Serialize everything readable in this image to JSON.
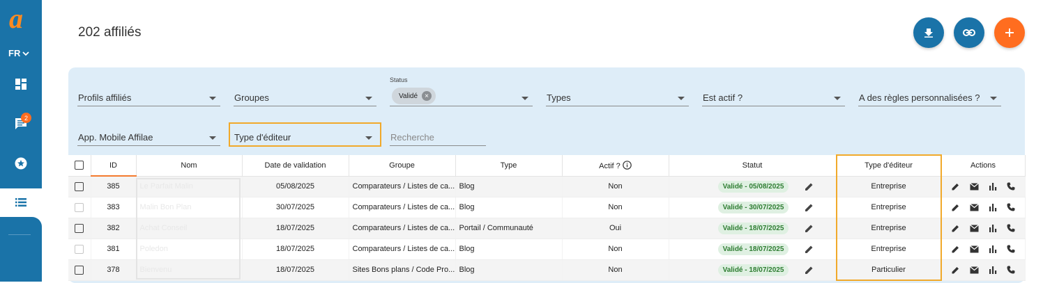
{
  "sidebar": {
    "language": "FR",
    "badge_count": "2",
    "brand_colors": {
      "primary": "#1a73a8",
      "accent": "#ff6d1f"
    }
  },
  "header": {
    "title": "202 affiliés",
    "actions": [
      {
        "icon": "download-icon",
        "color": "#1a73a8"
      },
      {
        "icon": "link-icon",
        "color": "#1a73a8"
      },
      {
        "icon": "plus-icon",
        "color": "#ff6d1f"
      }
    ]
  },
  "filters": {
    "profils": "Profils affiliés",
    "groupes": "Groupes",
    "status_label": "Status",
    "status_chip": "Validé",
    "types": "Types",
    "est_actif": "Est actif ?",
    "regles": "A des règles personnalisées ?",
    "app_mobile": "App. Mobile Affilae",
    "type_editeur": "Type d'éditeur",
    "search_placeholder": "Recherche"
  },
  "table": {
    "headers": {
      "id": "ID",
      "nom": "Nom",
      "date": "Date de validation",
      "groupe": "Groupe",
      "type": "Type",
      "actif": "Actif ?",
      "statut": "Statut",
      "type_editeur": "Type d'éditeur",
      "actions": "Actions"
    },
    "rows": [
      {
        "id": "385",
        "nom": "Le Parfait Malin",
        "date": "05/08/2025",
        "groupe": "Comparateurs / Listes de ca...",
        "type": "Blog",
        "actif": "Non",
        "statut": "Validé - 05/08/2025",
        "type_editeur": "Entreprise"
      },
      {
        "id": "383",
        "nom": "Malin Bon Plan",
        "date": "30/07/2025",
        "groupe": "Comparateurs / Listes de ca...",
        "type": "Blog",
        "actif": "Non",
        "statut": "Validé - 30/07/2025",
        "type_editeur": "Entreprise"
      },
      {
        "id": "382",
        "nom": "Achat Conseil",
        "date": "18/07/2025",
        "groupe": "Comparateurs / Listes de ca...",
        "type": "Portail / Communauté",
        "actif": "Oui",
        "statut": "Validé - 18/07/2025",
        "type_editeur": "Entreprise"
      },
      {
        "id": "381",
        "nom": "Poledon",
        "date": "18/07/2025",
        "groupe": "Comparateurs / Listes de ca...",
        "type": "Blog",
        "actif": "Non",
        "statut": "Validé - 18/07/2025",
        "type_editeur": "Entreprise"
      },
      {
        "id": "378",
        "nom": "Bienvenu",
        "date": "18/07/2025",
        "groupe": "Sites Bons plans / Code Pro...",
        "type": "Blog",
        "actif": "Non",
        "statut": "Validé - 18/07/2025",
        "type_editeur": "Particulier"
      }
    ]
  }
}
